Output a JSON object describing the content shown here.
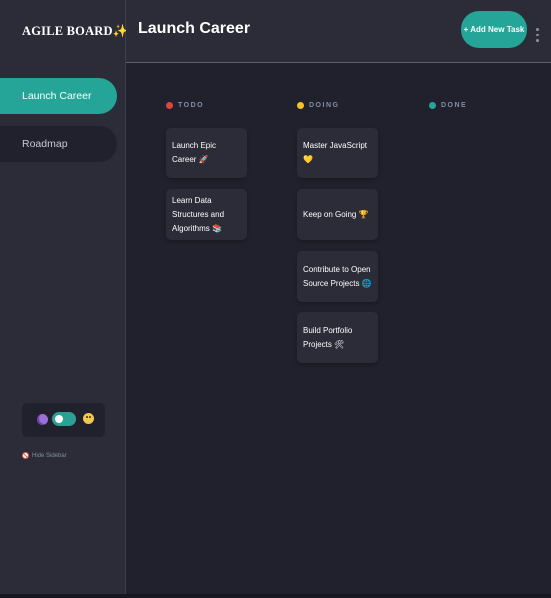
{
  "brand": {
    "title": "AGILE BOARD✨"
  },
  "sidebar": {
    "boards": [
      {
        "label": "Launch Career"
      },
      {
        "label": "Roadmap"
      }
    ],
    "hide_label": "Hide Sidebar"
  },
  "header": {
    "title": "Launch Career",
    "add_task_label": "+ Add New Task"
  },
  "columns": [
    {
      "name": "TODO",
      "color": "#e0453d",
      "tasks": [
        {
          "title": "Launch Epic Career 🚀"
        },
        {
          "title": "Learn Data Structures and Algorithms 📚"
        }
      ]
    },
    {
      "name": "DOING",
      "color": "#f3c323",
      "tasks": [
        {
          "title": "Master JavaScript 💛"
        },
        {
          "title": "Keep on Going 🏆"
        },
        {
          "title": "Contribute to Open Source Projects 🌐"
        },
        {
          "title": "Build Portfolio Projects 🛠"
        }
      ]
    },
    {
      "name": "DONE",
      "color": "#25a597",
      "tasks": []
    }
  ],
  "theme": {
    "dark_mode": true
  }
}
